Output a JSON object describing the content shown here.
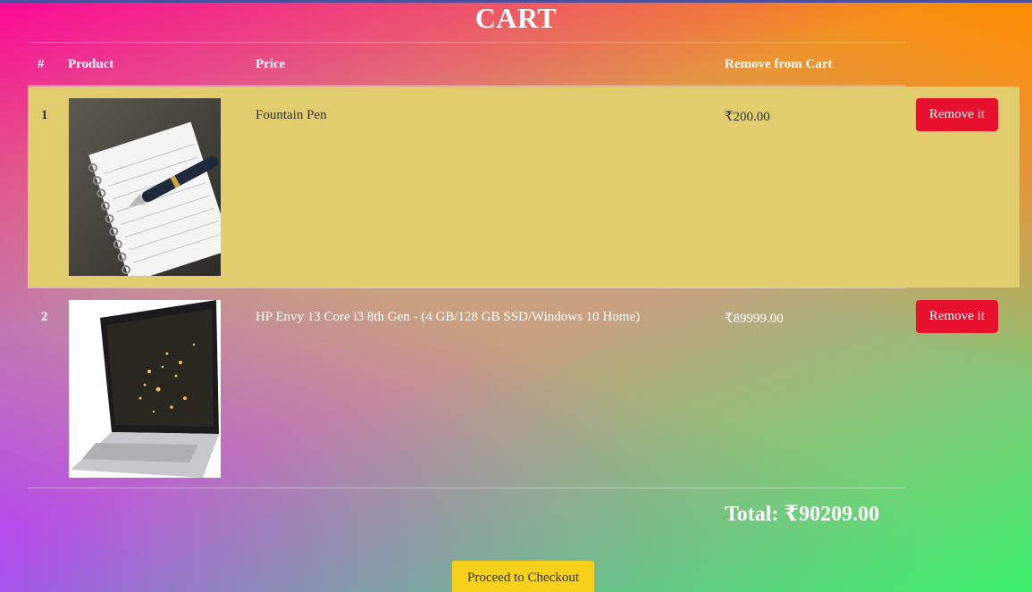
{
  "page": {
    "title": "CART"
  },
  "table": {
    "headers": {
      "index": "#",
      "product": "Product",
      "price": "Price",
      "remove": "Remove from Cart"
    },
    "rows": [
      {
        "index": "1",
        "name": "Fountain Pen",
        "price": "₹200.00",
        "remove_label": "Remove it",
        "image_icon": "fountain-pen-notebook-image"
      },
      {
        "index": "2",
        "name": "HP Envy 13 Core i3 8th Gen - (4 GB/128 GB SSD/Windows 10 Home)",
        "price": "₹89999.00",
        "remove_label": "Remove it",
        "image_icon": "laptop-image"
      }
    ]
  },
  "total": {
    "text": "Total: ₹90209.00"
  },
  "checkout": {
    "label": "Proceed to Checkout"
  },
  "colors": {
    "remove_button": "#e8112d",
    "checkout_button": "#f5d11c",
    "row_highlight": "#e1cd6e"
  }
}
